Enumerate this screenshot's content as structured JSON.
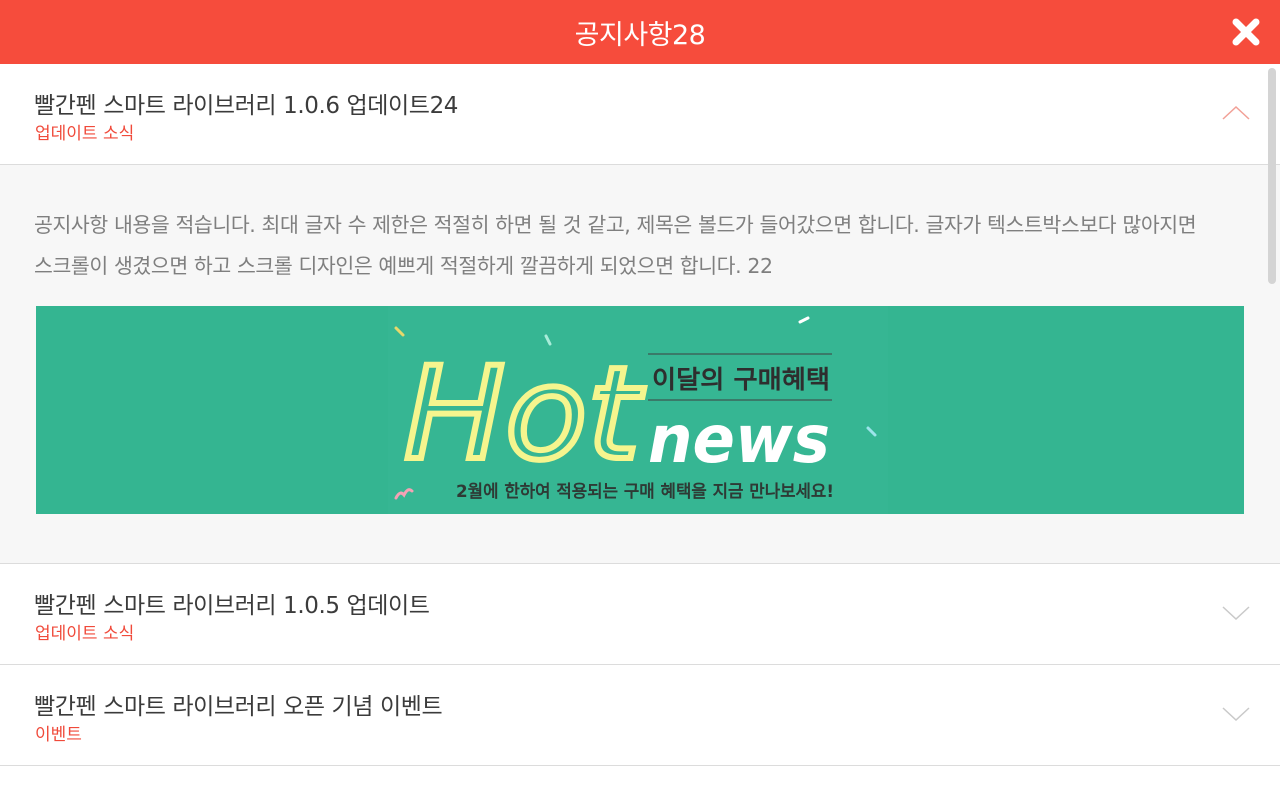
{
  "header": {
    "title": "공지사항28",
    "close_icon": "close-icon",
    "background": "#f64c3c"
  },
  "notices": [
    {
      "title": "빨간펜 스마트 라이브러리 1.0.6 업데이트24",
      "category": "업데이트 소식",
      "expanded": true,
      "chevron": "chevron-up-icon",
      "content": "공지사항 내용을 적습니다. 최대 글자 수 제한은 적절히 하면 될 것 같고, 제목은 볼드가 들어갔으면 합니다. 글자가 텍스트박스보다 많아지면 스크롤이 생겼으면 하고 스크롤 디자인은 예쁘게 적절하게 깔끔하게 되었으면 합니다. 22",
      "banner": {
        "hot_text": "Hot",
        "headline": "이달의 구매혜택",
        "news_text": "news",
        "subtext": "2월에 한하여 적용되는 구매 혜택을 지금 만나보세요!",
        "background": "#34b591"
      }
    },
    {
      "title": "빨간펜 스마트 라이브러리 1.0.5 업데이트",
      "category": "업데이트 소식",
      "expanded": false,
      "chevron": "chevron-down-icon"
    },
    {
      "title": "빨간펜 스마트 라이브러리 오픈 기념 이벤트",
      "category": "이벤트",
      "expanded": false,
      "chevron": "chevron-down-icon"
    }
  ],
  "colors": {
    "accent": "#f64c3c",
    "category": "#f04a3a",
    "title": "#3b3b3b",
    "body_text": "#7f7f7f"
  }
}
